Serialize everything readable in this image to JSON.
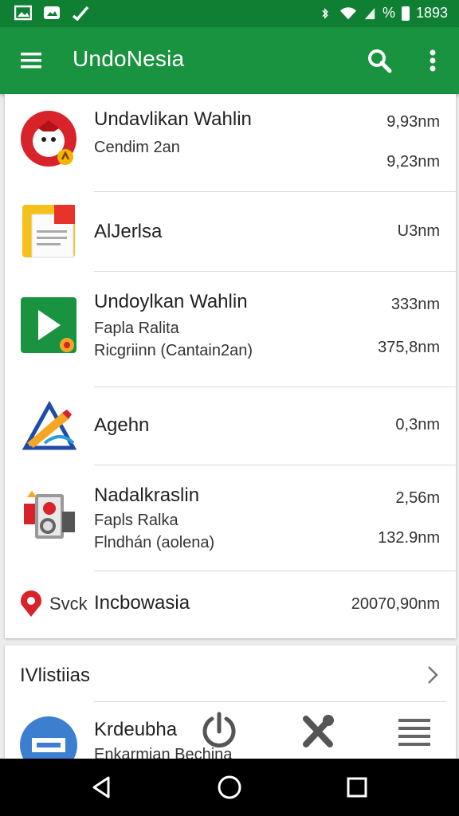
{
  "status_bar": {
    "time": "1893",
    "icons": [
      "image-icon",
      "photo-icon",
      "signal-check-icon",
      "bluetooth-icon",
      "wifi-icon",
      "cell-signal-icon",
      "percent-icon"
    ],
    "battery_text": "%"
  },
  "app_bar": {
    "title": "UndoNesia",
    "color": "#1a9340",
    "actions": [
      "search-icon",
      "more-vert-icon"
    ]
  },
  "list": [
    {
      "title": "Undavlikan Wahlin",
      "subtitle": "Cendim 2an",
      "value_top": "9,93nm",
      "value_bottom": "9,23nm",
      "icon": "red-mascot-icon"
    },
    {
      "title": "AlJerlsa",
      "value": "U3nm",
      "icon": "document-icon"
    },
    {
      "title": "Undoylkan Wahlin",
      "subtitle1": "Fapla Ralita",
      "subtitle2": "Ricgriinn (Cantain2an)",
      "value_top": "333nm",
      "value_bottom": "375,8nm",
      "icon": "play-icon"
    },
    {
      "title": "Agehn",
      "value": "0,3nm",
      "icon": "pencil-triangle-icon"
    },
    {
      "title": "Nadalkraslin",
      "subtitle1": "Fapls Ralka",
      "subtitle2": "Flndhán (aolena)",
      "value_top": "2,56m",
      "value_bottom": "132.9nm",
      "icon": "device-collage-icon"
    },
    {
      "prefix": "Svck",
      "title": "Incbowasia",
      "value": "20070,90nm",
      "icon": "location-pin-icon"
    }
  ],
  "section": {
    "title": "IVlistiias",
    "item_title": "Krdeubha",
    "item_subtitle": "Enkarmian Bechina"
  },
  "nav": [
    "back-icon",
    "home-icon",
    "recents-icon"
  ]
}
